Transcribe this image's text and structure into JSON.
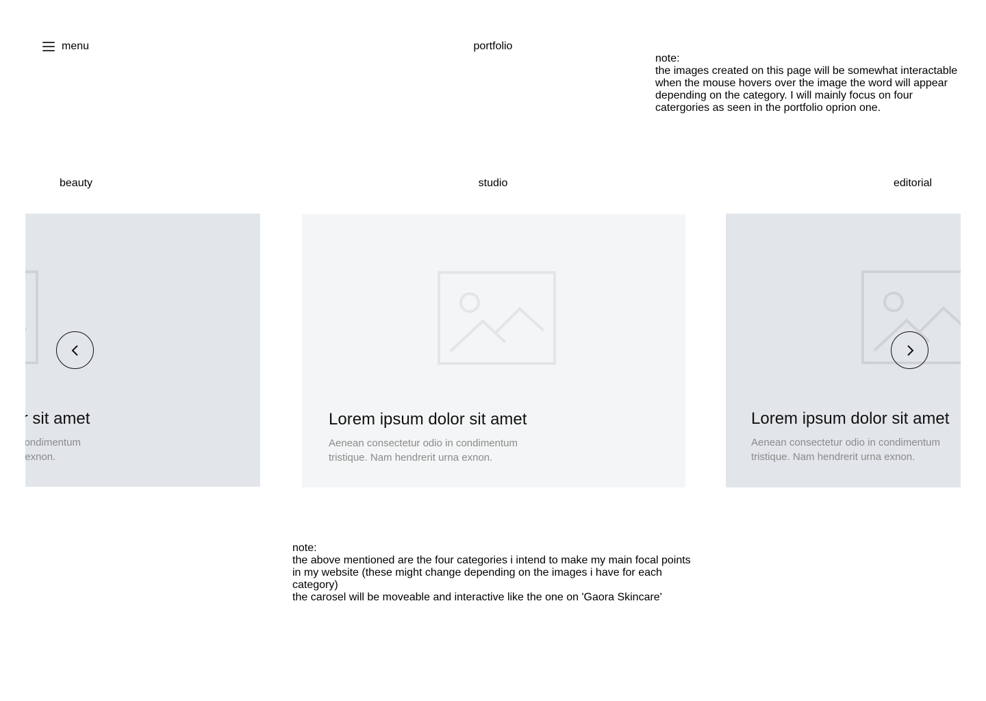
{
  "header": {
    "menu_label": "menu",
    "page_title": "portfolio"
  },
  "notes": {
    "top": {
      "label": "note:",
      "text": "the images created on this page will be somewhat interactable when the mouse hovers over the image the word will appear depending on the category. I will mainly focus on four catergories as seen in the portfolio oprion one."
    },
    "bottom": {
      "label": "note:",
      "line1": "the above mentioned are the four categories i intend to make my main focal points in my website (these might change depending on the images i have for each category)",
      "line2": "the carosel will be moveable and interactive like the one on 'Gaora Skincare'"
    }
  },
  "categories": [
    "beauty",
    "studio",
    "editorial"
  ],
  "cards": [
    {
      "title": "Lorem ipsum dolor sit amet",
      "description": "Aenean consectetur odio in condimentum tristique. Nam hendrerit urna exnon."
    },
    {
      "title": "Lorem ipsum dolor sit amet",
      "description": "Aenean consectetur odio in condimentum tristique. Nam hendrerit urna exnon."
    },
    {
      "title": "Lorem ipsum dolor sit amet",
      "description": "Aenean consectetur odio in condimentum tristique. Nam hendrerit urna exnon."
    }
  ],
  "carousel": {
    "prev_icon": "chevron-left-icon",
    "next_icon": "chevron-right-icon"
  },
  "colors": {
    "card_side": "#e2e5e9",
    "card_center": "#f4f5f6",
    "placeholder_stroke": "#cfd2d6",
    "description_text": "#8a8a8a"
  }
}
